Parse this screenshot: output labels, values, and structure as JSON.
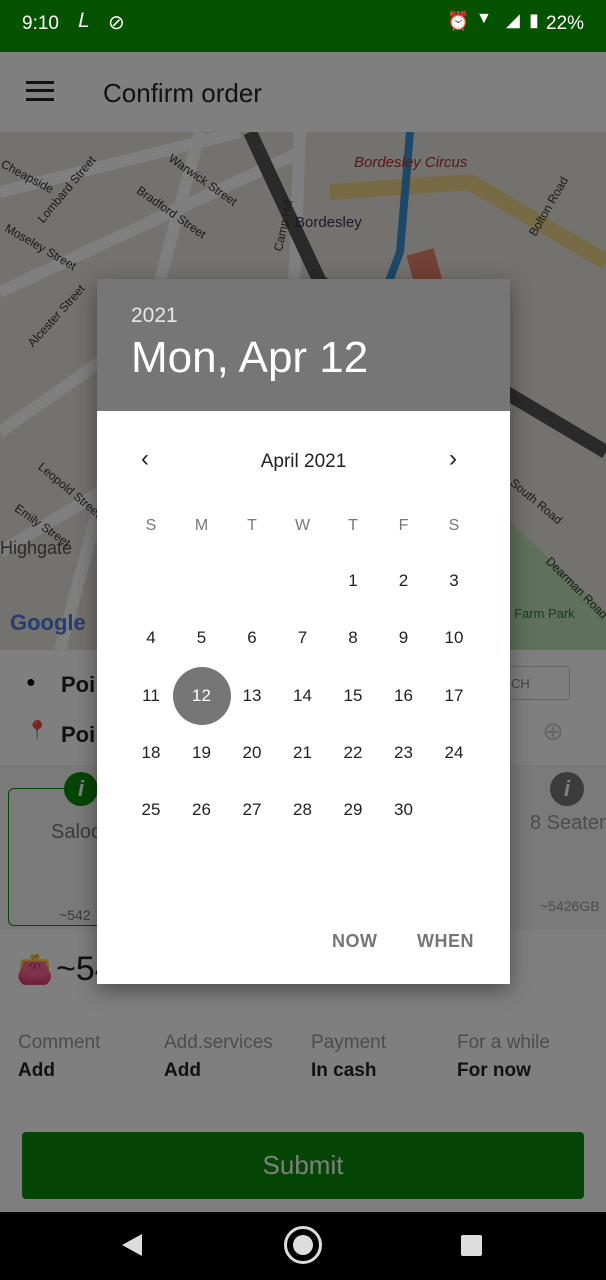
{
  "status_bar": {
    "time": "9:10",
    "battery": "22%",
    "icons": [
      "route-icon",
      "location-off-icon",
      "alarm-icon",
      "data-arrows-icon",
      "wifi-icon",
      "signal-icon",
      "battery-charging-icon"
    ]
  },
  "app_bar": {
    "title": "Confirm order",
    "menu_icon": "hamburger-menu-icon"
  },
  "map": {
    "labels": [
      "Bordesley Circus",
      "Bordesley",
      "Camp Hill",
      "Warwick Street",
      "Bradford Street",
      "Cheapside",
      "Lombard Street",
      "Moseley Street",
      "Alcester Street",
      "Highgate",
      "Leopold Street",
      "Emily Street",
      "Bolton Road",
      "Farm Park",
      "Dearman Road",
      "South Road"
    ],
    "logo": "Google"
  },
  "route": {
    "from": "Poi",
    "to": "Poi",
    "search_partial": "CH"
  },
  "cards": [
    {
      "name": "Saloo",
      "price": "~542"
    },
    {
      "name": "8 Seater",
      "price": "~5426GB"
    }
  ],
  "total_price": "~54",
  "options": [
    {
      "label": "Comment",
      "value": "Add"
    },
    {
      "label": "Add.services",
      "value": "Add"
    },
    {
      "label": "Payment",
      "value": "In cash"
    },
    {
      "label": "For a while",
      "value": "For now"
    }
  ],
  "submit_label": "Submit",
  "date_picker": {
    "year": "2021",
    "selected_date": "Mon, Apr 12",
    "month_label": "April 2021",
    "weekdays": [
      "S",
      "M",
      "T",
      "W",
      "T",
      "F",
      "S"
    ],
    "first_weekday_index": 4,
    "days_in_month": 30,
    "selected_day": 12,
    "now_label": "NOW",
    "when_label": "WHEN"
  },
  "colors": {
    "accent": "#767676",
    "status_bar": "#055200",
    "submit": "#0a8a0a"
  }
}
